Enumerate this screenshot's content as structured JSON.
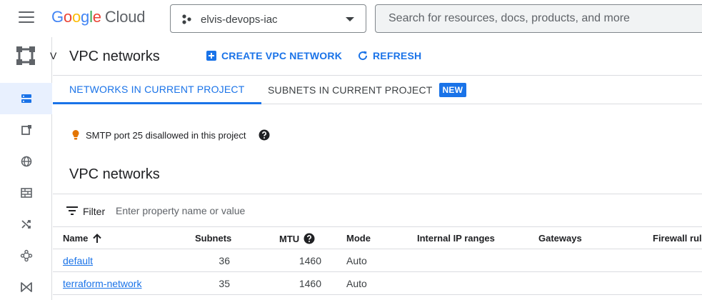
{
  "header": {
    "logo": {
      "g1": "G",
      "g2": "o",
      "g3": "o",
      "g4": "g",
      "g5": "l",
      "g6": "e",
      "cloud": "Cloud"
    },
    "project_name": "elvis-devops-iac",
    "search_placeholder": "Search for resources, docs, products, and more"
  },
  "rail": {
    "brand_letter": "V",
    "items": [
      "vpc-networks-icon",
      "ip-addresses-icon",
      "firewall-icon",
      "routes-icon",
      "peering-icon",
      "shared-vpc-icon",
      "connectors-icon"
    ]
  },
  "page": {
    "title": "VPC networks",
    "create_button": "CREATE VPC NETWORK",
    "refresh_button": "REFRESH"
  },
  "tabs": [
    {
      "label": "NETWORKS IN CURRENT PROJECT",
      "active": true
    },
    {
      "label": "SUBNETS IN CURRENT PROJECT",
      "active": false,
      "badge": "NEW"
    }
  ],
  "notice": {
    "text": "SMTP port 25 disallowed in this project"
  },
  "section_title": "VPC networks",
  "filter": {
    "label": "Filter",
    "placeholder": "Enter property name or value"
  },
  "table": {
    "columns": {
      "name": "Name",
      "subnets": "Subnets",
      "mtu": "MTU",
      "mode": "Mode",
      "internal_ip": "Internal IP ranges",
      "gateways": "Gateways",
      "firewall": "Firewall rules"
    },
    "rows": [
      {
        "name": "default",
        "subnets": "36",
        "mtu": "1460",
        "mode": "Auto"
      },
      {
        "name": "terraform-network",
        "subnets": "35",
        "mtu": "1460",
        "mode": "Auto"
      }
    ]
  },
  "colors": {
    "accent": "#1a73e8",
    "border": "#dadce0",
    "bulb": "#e37400"
  }
}
